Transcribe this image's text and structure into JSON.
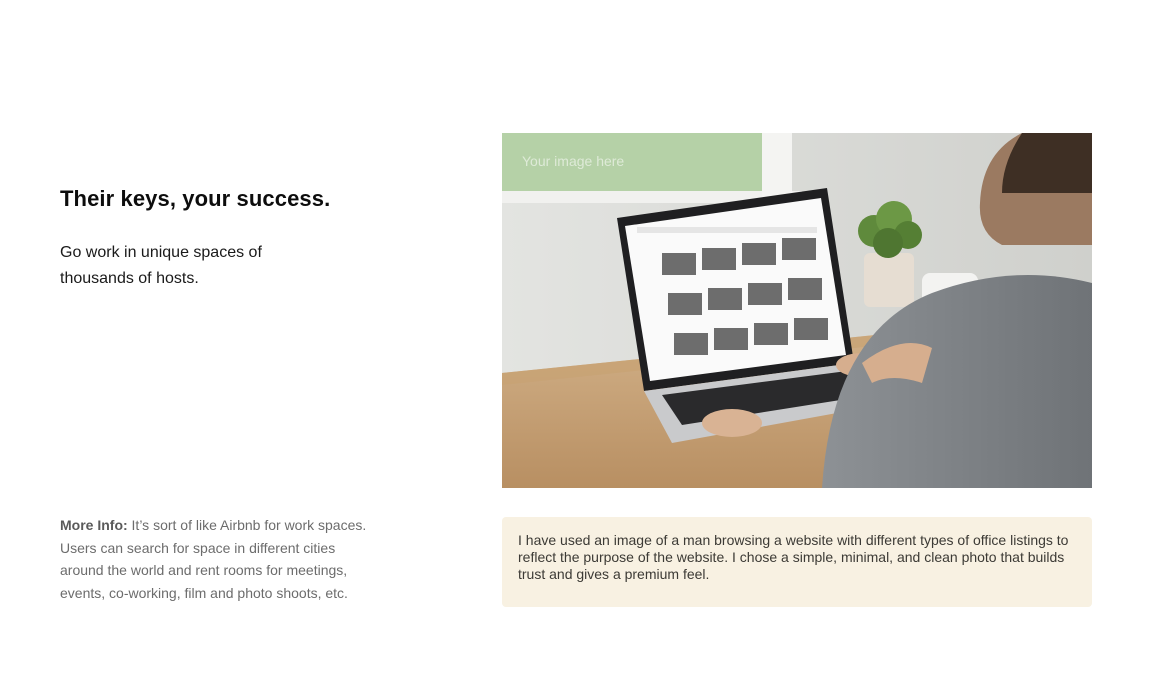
{
  "hero": {
    "title": "Their keys, your success.",
    "subtitle": "Go work in unique spaces of thousands of hosts."
  },
  "more_info": {
    "label": "More Info:",
    "text": " It’s sort of like Airbnb for work spaces. Users can search for space in different cities around the world and rent rooms for meetings, events, co-working, film and photo shoots, etc."
  },
  "image": {
    "placeholder": "Your image here",
    "subject": "man browsing office listings on laptop"
  },
  "note": {
    "text": "I have used an image of a man browsing a website with different types of office listings to reflect the purpose of the website. I chose a simple, minimal, and clean photo that builds trust and gives a premium feel."
  },
  "colors": {
    "note_background": "#f8f1e2",
    "heading": "#0d0d0d",
    "muted_text": "#6c6c6c"
  }
}
